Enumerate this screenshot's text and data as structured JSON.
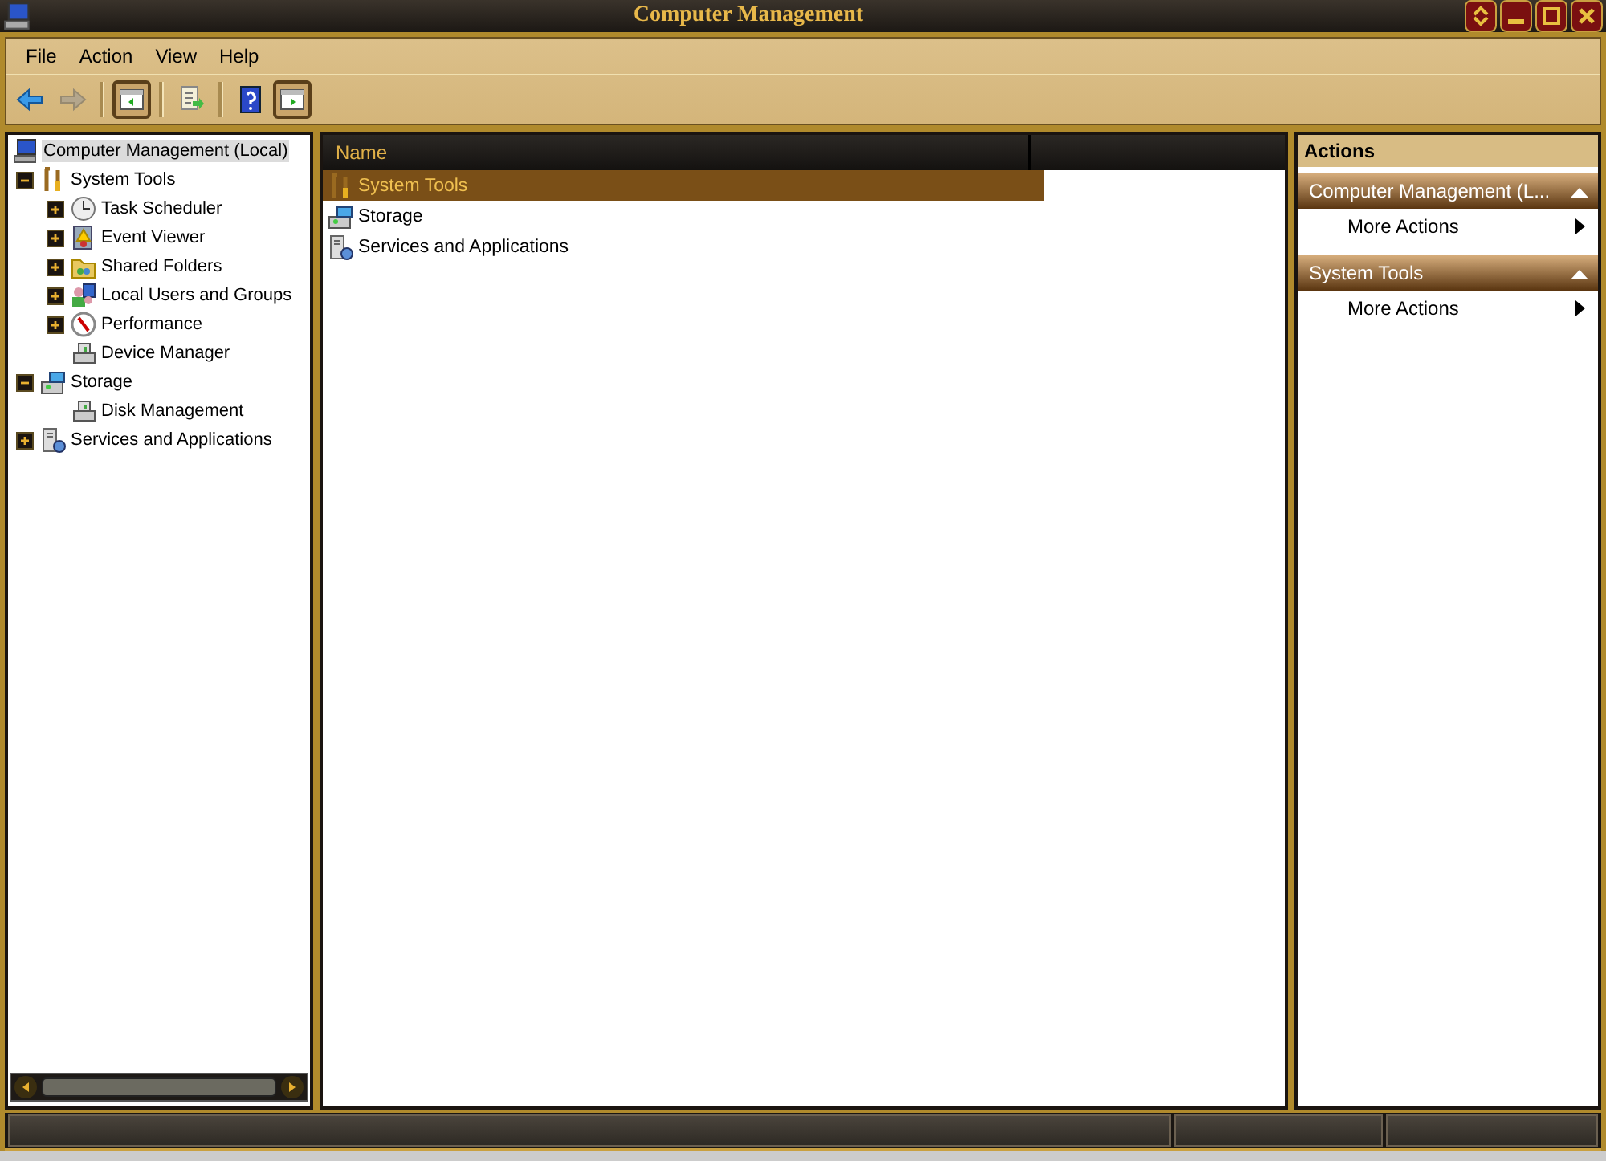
{
  "window": {
    "title": "Computer Management"
  },
  "menu": [
    "File",
    "Action",
    "View",
    "Help"
  ],
  "toolbar": [
    {
      "kind": "back",
      "disabled": false,
      "pressed": false
    },
    {
      "kind": "forward",
      "disabled": true,
      "pressed": false
    },
    {
      "kind": "separator"
    },
    {
      "kind": "console-tree",
      "disabled": false,
      "pressed": true
    },
    {
      "kind": "separator"
    },
    {
      "kind": "export",
      "disabled": false,
      "pressed": false
    },
    {
      "kind": "separator"
    },
    {
      "kind": "help",
      "disabled": false,
      "pressed": false
    },
    {
      "kind": "action-pane",
      "disabled": false,
      "pressed": true
    }
  ],
  "tree": [
    {
      "label": "Computer Management (Local)",
      "kind": "computer",
      "selected": true,
      "children": [
        {
          "label": "System Tools",
          "kind": "tools",
          "selected": false,
          "expanded": true,
          "children": [
            {
              "label": "Task Scheduler",
              "kind": "clock",
              "selected": false,
              "expanded": false
            },
            {
              "label": "Event Viewer",
              "kind": "log",
              "selected": false,
              "expanded": false
            },
            {
              "label": "Shared Folders",
              "kind": "folder",
              "selected": false,
              "expanded": false
            },
            {
              "label": "Local Users and Groups",
              "kind": "users",
              "selected": false,
              "expanded": false
            },
            {
              "label": "Performance",
              "kind": "gauge",
              "selected": false,
              "expanded": false
            },
            {
              "label": "Device Manager",
              "kind": "device",
              "selected": false
            }
          ]
        },
        {
          "label": "Storage",
          "kind": "storage",
          "selected": false,
          "expanded": true,
          "children": [
            {
              "label": "Disk Management",
              "kind": "device",
              "selected": false
            }
          ]
        },
        {
          "label": "Services and Applications",
          "kind": "services",
          "selected": false,
          "expanded": false
        }
      ]
    }
  ],
  "list": {
    "columns": [
      "Name"
    ],
    "rows": [
      {
        "name": "System Tools",
        "kind": "tools",
        "selected": true
      },
      {
        "name": "Storage",
        "kind": "storage",
        "selected": false
      },
      {
        "name": "Services and Applications",
        "kind": "services",
        "selected": false
      }
    ]
  },
  "actions": {
    "title": "Actions",
    "sections": [
      {
        "title": "Computer Management (L...",
        "expanded": true,
        "items": [
          "More Actions"
        ]
      },
      {
        "title": "System Tools",
        "expanded": true,
        "items": [
          "More Actions"
        ]
      }
    ]
  }
}
